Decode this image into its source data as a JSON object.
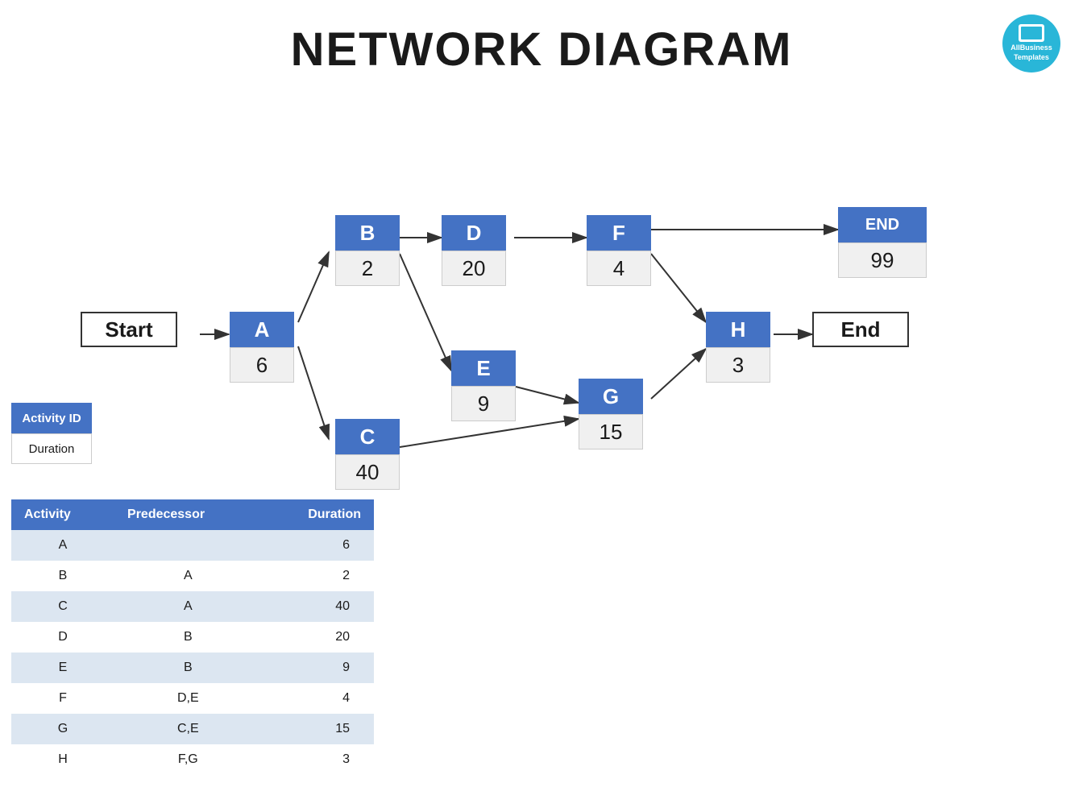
{
  "header": {
    "title": "NETWORK DIAGRAM"
  },
  "logo": {
    "line1": "AllBusiness",
    "line2": "Templates"
  },
  "legend": {
    "activity_id_label": "Activity ID",
    "duration_label": "Duration"
  },
  "nodes": {
    "start": {
      "label": "Start",
      "type": "white"
    },
    "A": {
      "id": "A",
      "duration": "6"
    },
    "B": {
      "id": "B",
      "duration": "2"
    },
    "C": {
      "id": "C",
      "duration": "40"
    },
    "D": {
      "id": "D",
      "duration": "20"
    },
    "E": {
      "id": "E",
      "duration": "9"
    },
    "F": {
      "id": "F",
      "duration": "4"
    },
    "G": {
      "id": "G",
      "duration": "15"
    },
    "H": {
      "id": "H",
      "duration": "3"
    },
    "end_node": {
      "label": "End",
      "type": "white"
    },
    "END": {
      "id": "END",
      "duration": "99"
    }
  },
  "table": {
    "columns": [
      "Activity",
      "Predecessor",
      "Duration"
    ],
    "rows": [
      {
        "activity": "A",
        "predecessor": "",
        "duration": "6"
      },
      {
        "activity": "B",
        "predecessor": "A",
        "duration": "2"
      },
      {
        "activity": "C",
        "predecessor": "A",
        "duration": "40"
      },
      {
        "activity": "D",
        "predecessor": "B",
        "duration": "20"
      },
      {
        "activity": "E",
        "predecessor": "B",
        "duration": "9"
      },
      {
        "activity": "F",
        "predecessor": "D,E",
        "duration": "4"
      },
      {
        "activity": "G",
        "predecessor": "C,E",
        "duration": "15"
      },
      {
        "activity": "H",
        "predecessor": "F,G",
        "duration": "3"
      }
    ]
  }
}
